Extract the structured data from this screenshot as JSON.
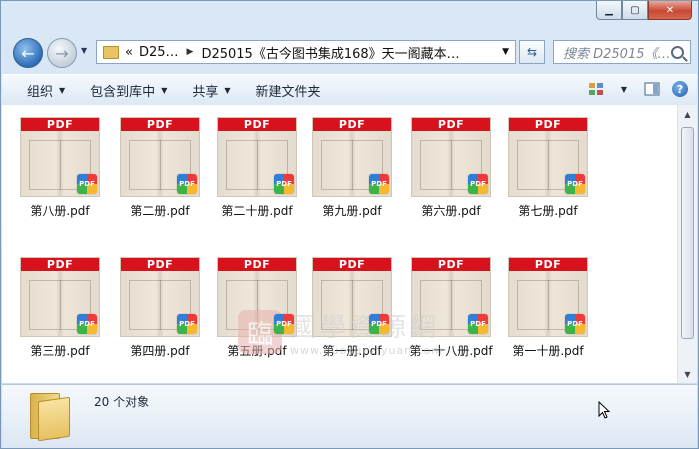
{
  "window": {
    "minimize_icon": "minimize-icon",
    "maximize_icon": "maximize-icon",
    "close_icon": "close-icon"
  },
  "navigation": {
    "back_icon": "back-arrow-icon",
    "forward_icon": "forward-arrow-icon",
    "address": {
      "overflow": "«",
      "crumb1": "D25…",
      "crumb2": "D25015《古今图书集成168》天一阁藏本…"
    },
    "search_placeholder": "搜索 D25015《…"
  },
  "toolbar": {
    "organize": "组织",
    "include_in_library": "包含到库中",
    "share": "共享",
    "new_folder": "新建文件夹"
  },
  "files": [
    {
      "name": "第八册.pdf",
      "badge": "PDF"
    },
    {
      "name": "第二册.pdf",
      "badge": "PDF"
    },
    {
      "name": "第二十册.pdf",
      "badge": "PDF"
    },
    {
      "name": "第九册.pdf",
      "badge": "PDF"
    },
    {
      "name": "第六册.pdf",
      "badge": "PDF"
    },
    {
      "name": "第七册.pdf",
      "badge": "PDF"
    },
    {
      "name": "第三册.pdf",
      "badge": "PDF"
    },
    {
      "name": "第四册.pdf",
      "badge": "PDF"
    },
    {
      "name": "第五册.pdf",
      "badge": "PDF"
    },
    {
      "name": "第一册.pdf",
      "badge": "PDF"
    },
    {
      "name": "第一十八册.pdf",
      "badge": "PDF"
    },
    {
      "name": "第一十册.pdf",
      "badge": "PDF"
    }
  ],
  "watermark": {
    "seal": "臨",
    "chinese": "國學資源網",
    "url": "www.guoxueziyuan.com"
  },
  "details": {
    "count": "20 个对象"
  }
}
